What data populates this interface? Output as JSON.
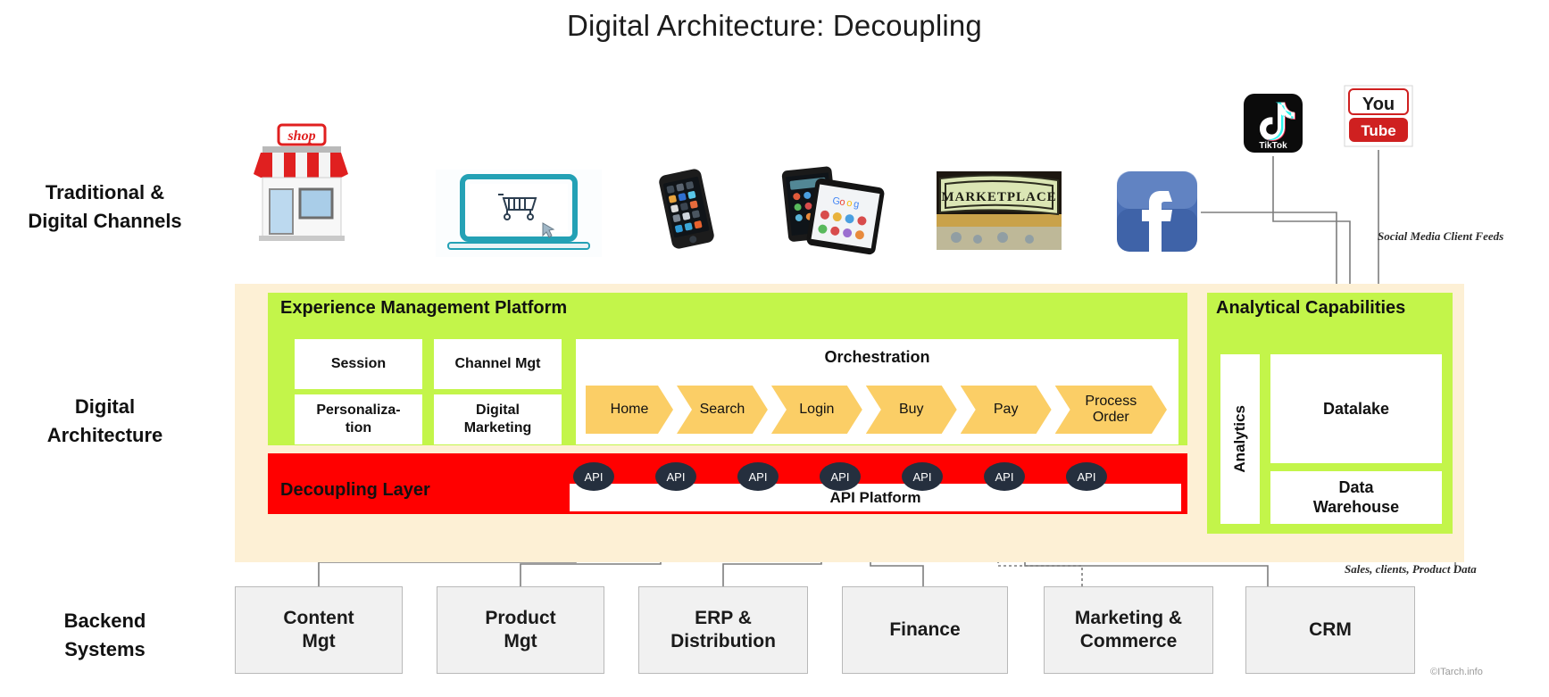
{
  "title": "Digital Architecture: Decoupling",
  "row_labels": {
    "channels": "Traditional &\nDigital Channels",
    "channels_line1": "Traditional &",
    "channels_line2": "Digital Channels",
    "digital_architecture_line1": "Digital",
    "digital_architecture_line2": "Architecture",
    "backend_line1": "Backend",
    "backend_line2": "Systems"
  },
  "channels": [
    {
      "name": "physical-store",
      "label": "shop",
      "icon": "storefront-icon"
    },
    {
      "name": "web-ecommerce",
      "label": "",
      "icon": "laptop-cart-icon"
    },
    {
      "name": "mobile-phone",
      "label": "",
      "icon": "smartphone-icon"
    },
    {
      "name": "tablet",
      "label": "",
      "icon": "tablet-icon"
    },
    {
      "name": "marketplace",
      "label": "MARKETPLACE",
      "icon": "marketplace-sign-icon"
    },
    {
      "name": "facebook",
      "label": "f",
      "icon": "facebook-icon"
    },
    {
      "name": "tiktok",
      "label": "TikTok",
      "icon": "tiktok-icon"
    },
    {
      "name": "youtube",
      "label": "You Tube",
      "icon": "youtube-icon"
    }
  ],
  "experience_platform": {
    "title": "Experience Management Platform",
    "cards": [
      "Session",
      "Channel Mgt",
      "Personaliza-\ntion",
      "Digital\nMarketing"
    ],
    "orchestration": {
      "title": "Orchestration",
      "steps": [
        "Home",
        "Search",
        "Login",
        "Buy",
        "Pay",
        "Process\nOrder"
      ]
    }
  },
  "decoupling_layer": {
    "title": "Decoupling Layer",
    "api_platform": "API Platform",
    "api_nodes": [
      "API",
      "API",
      "API",
      "API",
      "API",
      "API",
      "API"
    ],
    "color": "#ff0000"
  },
  "analytical_capabilities": {
    "title": "Analytical Capabilities",
    "vertical_label": "Analytics",
    "boxes": [
      "Datalake",
      "Data\nWarehouse"
    ]
  },
  "backend_systems": [
    "Content\nMgt",
    "Product\nMgt",
    "ERP &\nDistribution",
    "Finance",
    "Marketing &\nCommerce",
    "CRM"
  ],
  "annotations": {
    "social_feeds": "Social Media Client Feeds",
    "sales_data": "Sales, clients, Product Data",
    "credit": "©ITarch.info"
  },
  "colors": {
    "platform_frame": "#fdf0d5",
    "green_panel": "#c3f54a",
    "red_layer": "#ff0000",
    "chevron": "#fbce66",
    "api_node": "#252f3e",
    "backend_box": "#f1f1f1",
    "connector": "#808080"
  }
}
